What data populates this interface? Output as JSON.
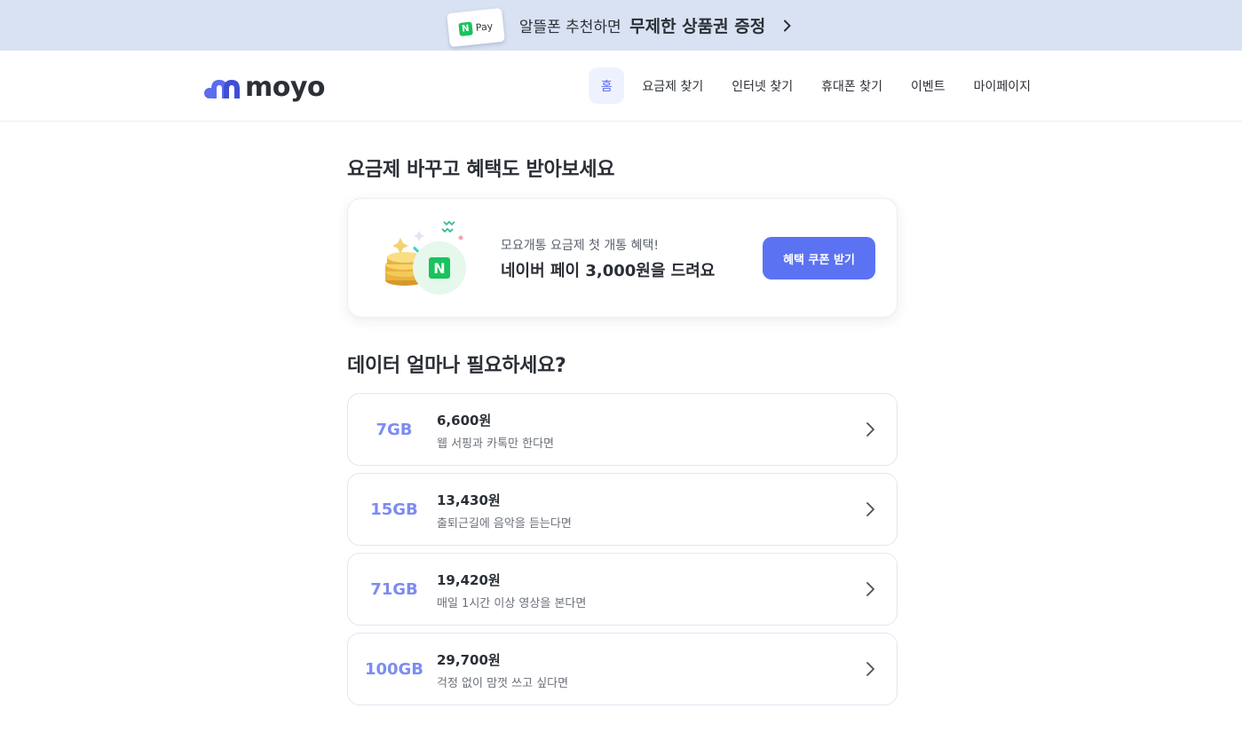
{
  "promo": {
    "pay_badge_letter": "N",
    "pay_badge_text": "Pay",
    "text": "알뜰폰 추천하면",
    "strong": "무제한 상품권 증정"
  },
  "header": {
    "logo_text": "moyo",
    "nav": [
      {
        "label": "홈",
        "active": true
      },
      {
        "label": "요금제 찾기",
        "active": false
      },
      {
        "label": "인터넷 찾기",
        "active": false
      },
      {
        "label": "휴대폰 찾기",
        "active": false
      },
      {
        "label": "이벤트",
        "active": false
      },
      {
        "label": "마이페이지",
        "active": false
      }
    ]
  },
  "benefit": {
    "section_title": "요금제 바꾸고 혜택도 받아보세요",
    "subtitle": "모요개통 요금제 첫 개통 혜택!",
    "title": "네이버 페이 3,000원을 드려요",
    "button_label": "혜택 쿠폰 받기",
    "badge_letter": "N"
  },
  "data_section": {
    "title": "데이터 얼마나 필요하세요?",
    "plans": [
      {
        "data": "7GB",
        "price": "6,600원",
        "desc": "웹 서핑과 카톡만 한다면"
      },
      {
        "data": "15GB",
        "price": "13,430원",
        "desc": "출퇴근길에 음악을 듣는다면"
      },
      {
        "data": "71GB",
        "price": "19,420원",
        "desc": "매일 1시간 이상 영상을 본다면"
      },
      {
        "data": "100GB",
        "price": "29,700원",
        "desc": "걱정 없이 맘껏 쓰고 싶다면"
      }
    ]
  },
  "colors": {
    "promo_bg": "#d9e2f3",
    "accent": "#5b73f2",
    "gb_text": "#7b8cf2",
    "naver_green": "#19c35d"
  },
  "icons": {
    "promo_arrow": "chevron-right-icon",
    "plan_arrow": "chevron-right-icon",
    "logo_mark": "moyo-logo-icon",
    "benefit_illustration": "coins-icon"
  }
}
